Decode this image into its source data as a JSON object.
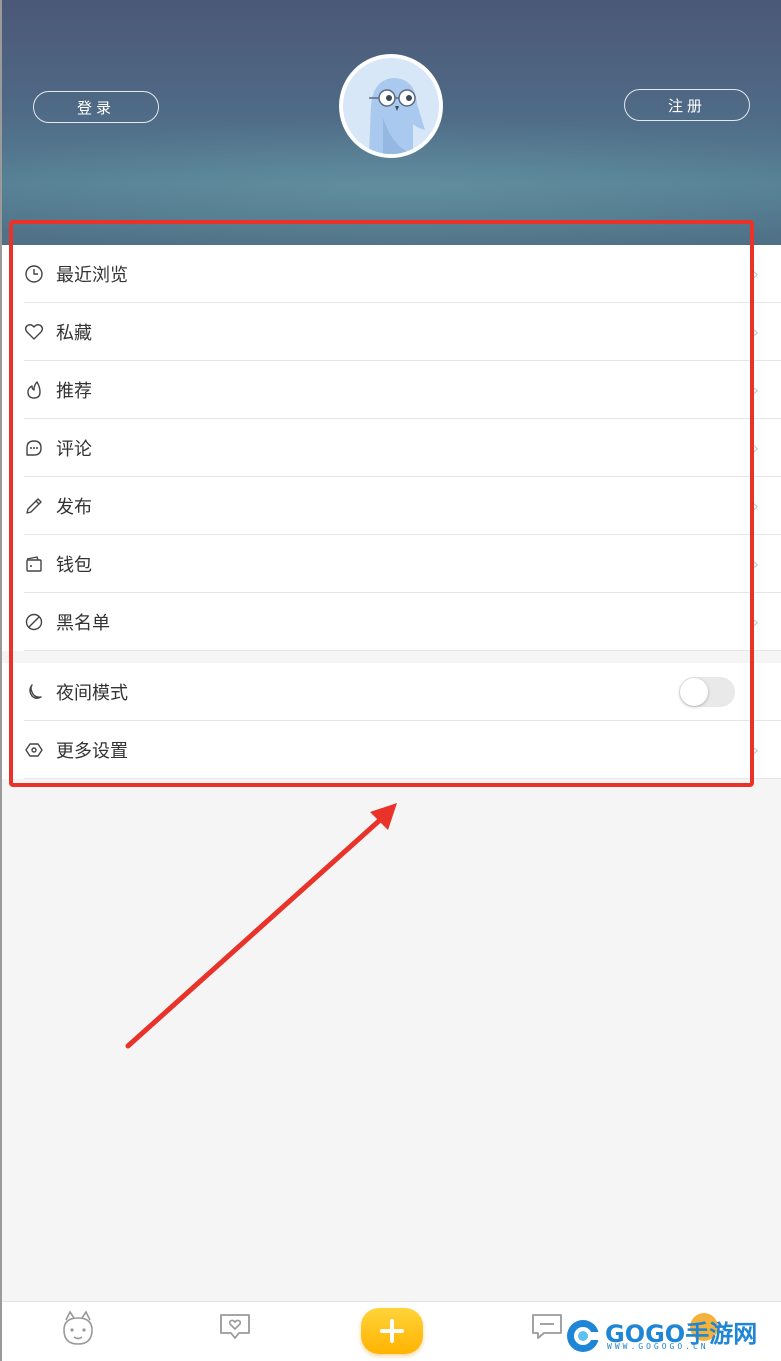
{
  "header": {
    "login_label": "登录",
    "register_label": "注册"
  },
  "menu": {
    "group1": [
      {
        "label": "最近浏览",
        "icon": "clock-icon"
      },
      {
        "label": "私藏",
        "icon": "heart-icon"
      },
      {
        "label": "推荐",
        "icon": "flame-icon"
      },
      {
        "label": "评论",
        "icon": "comment-icon"
      },
      {
        "label": "发布",
        "icon": "pencil-icon"
      },
      {
        "label": "钱包",
        "icon": "wallet-icon"
      },
      {
        "label": "黑名单",
        "icon": "block-icon"
      }
    ],
    "group2": [
      {
        "label": "夜间模式",
        "icon": "moon-icon",
        "toggle_on": false
      },
      {
        "label": "更多设置",
        "icon": "settings-icon"
      }
    ]
  },
  "bottom_nav": {
    "items": [
      "dragon-home-icon",
      "heart-chat-icon",
      "plus-icon",
      "message-icon",
      "profile-badge-icon"
    ]
  },
  "watermark": {
    "text": "GOGO手游网",
    "sub": "WWW.GOGOGO.CN"
  },
  "colors": {
    "annotation": "#e8322a",
    "accent": "#ffb300"
  }
}
